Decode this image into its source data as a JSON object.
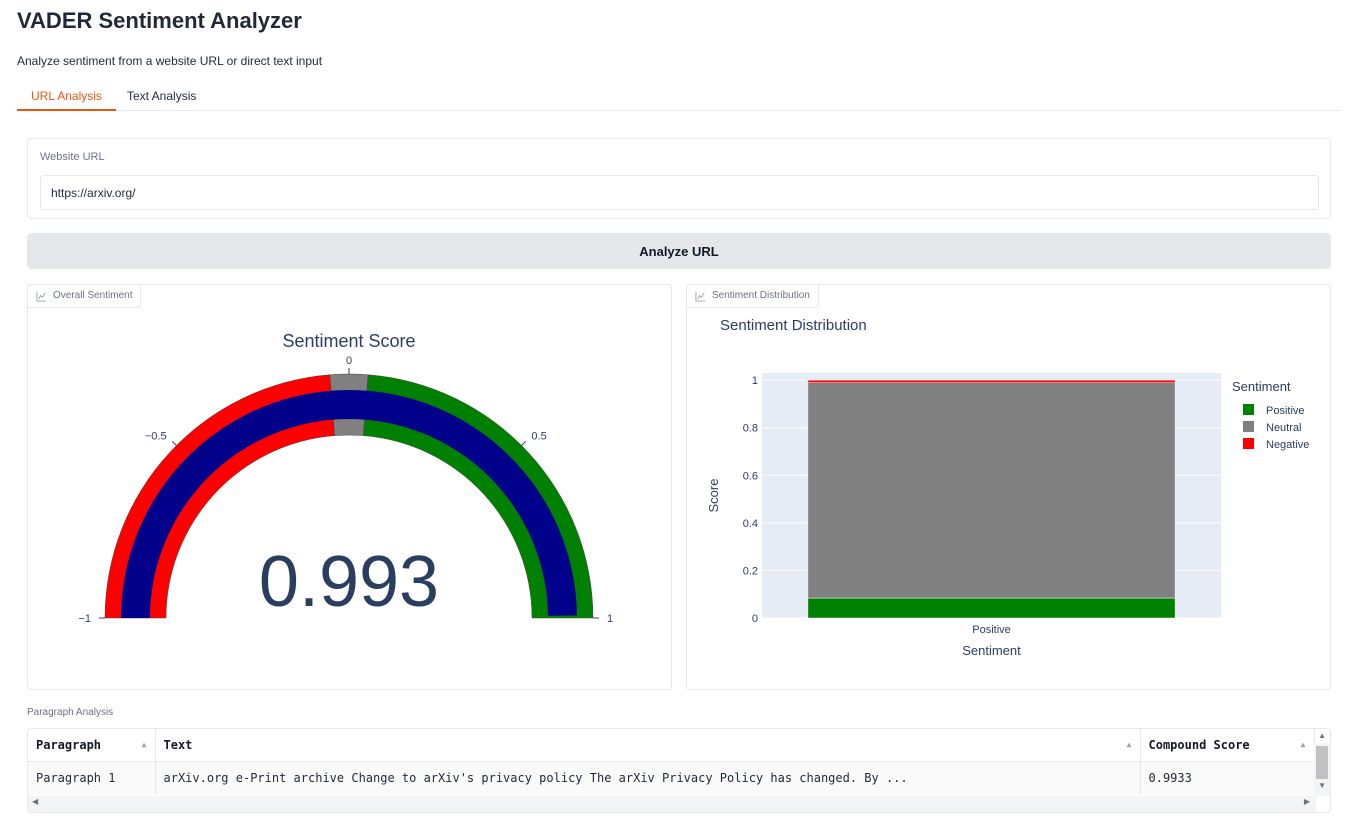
{
  "app": {
    "title": "VADER Sentiment Analyzer",
    "subtitle": "Analyze sentiment from a website URL or direct text input"
  },
  "tabs": [
    {
      "label": "URL Analysis",
      "active": true
    },
    {
      "label": "Text Analysis",
      "active": false
    }
  ],
  "url_input": {
    "label": "Website URL",
    "value": "https://arxiv.org/"
  },
  "analyze_button": {
    "label": "Analyze URL"
  },
  "colors": {
    "accent": "#ea580c",
    "positive": "#008000",
    "neutral": "#808080",
    "negative": "#ff0000",
    "gauge_bar": "#00008b",
    "plot_bg": "#e5ecf6",
    "plot_text": "#2a3f5f"
  },
  "panels": {
    "overall": {
      "label": "Overall Sentiment",
      "icon": "chart-icon"
    },
    "distribution": {
      "label": "Sentiment Distribution",
      "icon": "chart-icon"
    }
  },
  "chart_data": [
    {
      "type": "gauge",
      "title": "Sentiment Score",
      "value": 0.993,
      "value_text": "0.993",
      "range": [
        -1,
        1
      ],
      "ticks": [
        {
          "value": -1,
          "label": "−1"
        },
        {
          "value": -0.5,
          "label": "−0.5"
        },
        {
          "value": 0,
          "label": "0"
        },
        {
          "value": 0.5,
          "label": "0.5"
        },
        {
          "value": 1,
          "label": "1"
        }
      ],
      "steps": [
        {
          "range": [
            -1,
            -0.05
          ],
          "color": "#ff0000"
        },
        {
          "range": [
            -0.05,
            0.05
          ],
          "color": "#808080"
        },
        {
          "range": [
            0.05,
            1
          ],
          "color": "#008000"
        }
      ],
      "bar_color": "#00008b"
    },
    {
      "type": "bar",
      "stacked": true,
      "title": "Sentiment Distribution",
      "xlabel": "Sentiment",
      "ylabel": "Score",
      "categories": [
        "Positive"
      ],
      "ylim": [
        0,
        1.03
      ],
      "yticks": [
        {
          "value": 0,
          "label": "0"
        },
        {
          "value": 0.2,
          "label": "0.2"
        },
        {
          "value": 0.4,
          "label": "0.4"
        },
        {
          "value": 0.6,
          "label": "0.6"
        },
        {
          "value": 0.8,
          "label": "0.8"
        },
        {
          "value": 1,
          "label": "1"
        }
      ],
      "legend_title": "Sentiment",
      "legend_position": "right",
      "grid": true,
      "series": [
        {
          "name": "Positive",
          "values": [
            0.084
          ],
          "color": "#008000"
        },
        {
          "name": "Neutral",
          "values": [
            0.905
          ],
          "color": "#808080"
        },
        {
          "name": "Negative",
          "values": [
            0.011
          ],
          "color": "#ff0000"
        }
      ]
    }
  ],
  "paragraph_analysis": {
    "label": "Paragraph Analysis",
    "columns": [
      "Paragraph",
      "Text",
      "Compound Score"
    ],
    "rows": [
      [
        "Paragraph 1",
        "arXiv.org e-Print archive Change to arXiv's privacy policy The arXiv Privacy Policy has changed. By ...",
        "0.9933"
      ]
    ]
  }
}
